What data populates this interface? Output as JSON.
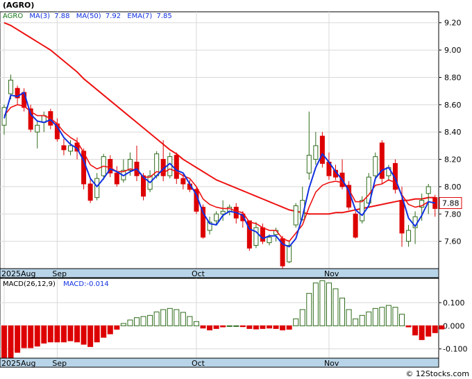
{
  "ticker_label": "(AGRO)",
  "watermark": "© 12Stocks.com",
  "colors": {
    "up": "#2e6b1a",
    "down": "#dd0000",
    "ma3": "#1030e0",
    "ma50": "#ee1010",
    "macd_pos": "#2e6b1a",
    "macd_neg": "#dd0000",
    "axis_band": "#b8d4e8"
  },
  "chart_data": [
    {
      "type": "candlestick",
      "legend": {
        "symbol": "AGRO",
        "items": [
          {
            "label": "MA(3)",
            "value": "7.88"
          },
          {
            "label": "MA(50)",
            "value": "7.92"
          },
          {
            "label": "EMA(7)",
            "value": "7.85"
          }
        ]
      },
      "last_price_label": "7.88",
      "ylim": [
        7.4,
        9.28
      ],
      "y_ticks": [
        "7.60",
        "7.80",
        "8.00",
        "8.20",
        "8.40",
        "8.60",
        "8.80",
        "9.00",
        "9.20"
      ],
      "x_labels": [
        {
          "label": "2025Aug",
          "index": 0
        },
        {
          "label": "Sep",
          "index": 8
        },
        {
          "label": "Oct",
          "index": 29
        },
        {
          "label": "Nov",
          "index": 49
        }
      ],
      "candles": [
        [
          8.45,
          8.58,
          8.38,
          8.6
        ],
        [
          8.68,
          8.78,
          8.64,
          8.82
        ],
        [
          8.72,
          8.65,
          8.6,
          8.74
        ],
        [
          8.69,
          8.58,
          8.55,
          8.72
        ],
        [
          8.57,
          8.42,
          8.4,
          8.6
        ],
        [
          8.4,
          8.45,
          8.28,
          8.48
        ],
        [
          8.47,
          8.52,
          8.4,
          8.55
        ],
        [
          8.55,
          8.45,
          8.42,
          8.57
        ],
        [
          8.46,
          8.35,
          8.33,
          8.5
        ],
        [
          8.3,
          8.27,
          8.23,
          8.35
        ],
        [
          8.26,
          8.3,
          8.23,
          8.34
        ],
        [
          8.32,
          8.26,
          8.2,
          8.36
        ],
        [
          8.26,
          8.02,
          7.98,
          8.28
        ],
        [
          8.02,
          7.9,
          7.88,
          8.06
        ],
        [
          7.92,
          8.06,
          7.9,
          8.1
        ],
        [
          8.08,
          8.22,
          8.05,
          8.24
        ],
        [
          8.2,
          8.1,
          8.07,
          8.23
        ],
        [
          8.1,
          8.02,
          8.0,
          8.15
        ],
        [
          8.05,
          8.12,
          8.03,
          8.2
        ],
        [
          8.12,
          8.2,
          8.08,
          8.25
        ],
        [
          8.18,
          8.08,
          8.04,
          8.3
        ],
        [
          8.08,
          7.93,
          7.9,
          8.1
        ],
        [
          7.98,
          8.08,
          7.96,
          8.12
        ],
        [
          8.08,
          8.24,
          8.06,
          8.26
        ],
        [
          8.2,
          8.08,
          8.04,
          8.34
        ],
        [
          8.08,
          8.22,
          8.06,
          8.25
        ],
        [
          8.23,
          8.06,
          8.02,
          8.25
        ],
        [
          8.06,
          8.02,
          7.98,
          8.09
        ],
        [
          8.02,
          7.98,
          7.96,
          8.05
        ],
        [
          7.98,
          7.82,
          7.8,
          8.0
        ],
        [
          7.85,
          7.63,
          7.62,
          7.87
        ],
        [
          7.68,
          7.74,
          7.65,
          7.78
        ],
        [
          7.75,
          7.8,
          7.72,
          7.82
        ],
        [
          7.8,
          7.82,
          7.75,
          7.9
        ],
        [
          7.82,
          7.85,
          7.79,
          7.87
        ],
        [
          7.85,
          7.77,
          7.73,
          7.88
        ],
        [
          7.8,
          7.75,
          7.7,
          7.82
        ],
        [
          7.75,
          7.55,
          7.53,
          7.75
        ],
        [
          7.57,
          7.7,
          7.55,
          7.74
        ],
        [
          7.7,
          7.6,
          7.58,
          7.73
        ],
        [
          7.59,
          7.63,
          7.57,
          7.65
        ],
        [
          7.65,
          7.68,
          7.6,
          7.7
        ],
        [
          7.62,
          7.42,
          7.4,
          7.64
        ],
        [
          7.45,
          7.57,
          7.44,
          7.6
        ],
        [
          7.72,
          7.86,
          7.7,
          7.88
        ],
        [
          7.76,
          7.9,
          7.75,
          8.0
        ],
        [
          8.1,
          8.23,
          8.05,
          8.55
        ],
        [
          8.2,
          8.3,
          8.16,
          8.4
        ],
        [
          8.37,
          8.17,
          8.14,
          8.4
        ],
        [
          8.18,
          8.08,
          8.05,
          8.25
        ],
        [
          8.12,
          8.07,
          8.05,
          8.16
        ],
        [
          8.1,
          8.0,
          7.98,
          8.2
        ],
        [
          8.01,
          7.85,
          7.83,
          8.04
        ],
        [
          7.8,
          7.63,
          7.62,
          7.82
        ],
        [
          7.75,
          7.9,
          7.73,
          7.93
        ],
        [
          7.88,
          8.07,
          7.85,
          8.1
        ],
        [
          8.08,
          8.22,
          8.05,
          8.25
        ],
        [
          8.32,
          8.06,
          8.02,
          8.34
        ],
        [
          8.08,
          8.14,
          8.05,
          8.16
        ],
        [
          8.17,
          7.98,
          7.95,
          8.2
        ],
        [
          7.9,
          7.66,
          7.56,
          8.0
        ],
        [
          7.6,
          7.68,
          7.56,
          7.72
        ],
        [
          7.7,
          7.78,
          7.58,
          7.82
        ],
        [
          7.85,
          7.9,
          7.75,
          7.95
        ],
        [
          7.95,
          8.0,
          7.8,
          8.02
        ],
        [
          7.92,
          7.84,
          7.78,
          7.94
        ]
      ],
      "ma3": [
        8.5,
        8.67,
        8.66,
        8.69,
        8.53,
        8.48,
        8.47,
        8.49,
        8.44,
        8.36,
        8.31,
        8.28,
        8.19,
        8.06,
        8.0,
        8.06,
        8.13,
        8.11,
        8.08,
        8.11,
        8.13,
        8.07,
        8.03,
        8.08,
        8.13,
        8.17,
        8.12,
        8.1,
        8.02,
        7.94,
        7.81,
        7.73,
        7.72,
        7.79,
        7.82,
        7.81,
        7.79,
        7.69,
        7.67,
        7.62,
        7.64,
        7.64,
        7.58,
        7.56,
        7.62,
        7.78,
        7.99,
        8.14,
        8.24,
        8.18,
        8.11,
        8.05,
        7.97,
        7.83,
        7.79,
        7.86,
        8.06,
        8.12,
        8.14,
        8.06,
        7.93,
        7.77,
        7.71,
        7.79,
        7.89,
        7.88
      ],
      "ema7": [
        8.52,
        8.58,
        8.6,
        8.59,
        8.55,
        8.52,
        8.52,
        8.5,
        8.46,
        8.4,
        8.36,
        8.33,
        8.25,
        8.16,
        8.13,
        8.15,
        8.14,
        8.11,
        8.11,
        8.13,
        8.12,
        8.07,
        8.07,
        8.11,
        8.1,
        8.13,
        8.11,
        8.08,
        8.06,
        8.0,
        7.91,
        7.87,
        7.85,
        7.84,
        7.84,
        7.82,
        7.81,
        7.74,
        7.73,
        7.7,
        7.68,
        7.68,
        7.62,
        7.6,
        7.66,
        7.72,
        7.85,
        7.96,
        8.01,
        8.03,
        8.04,
        8.03,
        7.98,
        7.89,
        7.89,
        7.94,
        8.01,
        8.02,
        8.05,
        8.03,
        7.94,
        7.87,
        7.85,
        7.86,
        7.89,
        7.88
      ],
      "ma50": [
        9.2,
        9.18,
        9.15,
        9.12,
        9.09,
        9.06,
        9.03,
        9.0,
        8.96,
        8.92,
        8.88,
        8.84,
        8.79,
        8.75,
        8.71,
        8.67,
        8.63,
        8.59,
        8.55,
        8.51,
        8.47,
        8.43,
        8.39,
        8.35,
        8.31,
        8.27,
        8.24,
        8.2,
        8.17,
        8.14,
        8.11,
        8.08,
        8.05,
        8.03,
        8.01,
        7.99,
        7.97,
        7.95,
        7.93,
        7.91,
        7.89,
        7.87,
        7.85,
        7.83,
        7.82,
        7.81,
        7.8,
        7.8,
        7.8,
        7.8,
        7.81,
        7.81,
        7.82,
        7.83,
        7.84,
        7.85,
        7.86,
        7.87,
        7.88,
        7.89,
        7.9,
        7.9,
        7.91,
        7.91,
        7.92,
        7.92
      ]
    },
    {
      "type": "bar",
      "legend": {
        "items": [
          {
            "label": "MACD(26,12,9)"
          },
          {
            "label": "MACD:-0.014"
          }
        ]
      },
      "ylim": [
        -0.14,
        0.205
      ],
      "y_ticks": [
        "0.100",
        "0.000",
        "-0.100"
      ],
      "x_labels": [
        {
          "label": "2025Aug",
          "index": 0
        },
        {
          "label": "Sep",
          "index": 8
        },
        {
          "label": "Oct",
          "index": 29
        },
        {
          "label": "Nov",
          "index": 49
        }
      ],
      "values": [
        -0.165,
        -0.14,
        -0.115,
        -0.095,
        -0.095,
        -0.088,
        -0.075,
        -0.07,
        -0.07,
        -0.07,
        -0.065,
        -0.07,
        -0.08,
        -0.09,
        -0.07,
        -0.05,
        -0.035,
        -0.015,
        0.01,
        0.025,
        0.035,
        0.04,
        0.045,
        0.06,
        0.07,
        0.075,
        0.07,
        0.058,
        0.04,
        0.018,
        -0.01,
        -0.018,
        -0.012,
        -0.005,
        0.0,
        0.0,
        -0.004,
        -0.012,
        -0.014,
        -0.012,
        -0.01,
        -0.012,
        -0.018,
        -0.015,
        0.03,
        0.07,
        0.14,
        0.185,
        0.195,
        0.185,
        0.16,
        0.12,
        0.07,
        0.03,
        0.045,
        0.06,
        0.075,
        0.08,
        0.088,
        0.08,
        0.05,
        -0.005,
        -0.04,
        -0.06,
        -0.045,
        -0.03,
        -0.014
      ]
    }
  ]
}
